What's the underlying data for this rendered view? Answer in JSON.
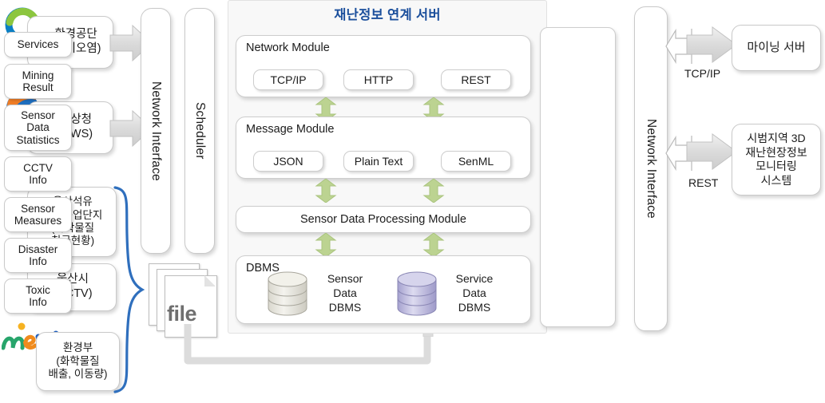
{
  "server": {
    "title": "재난정보 연계 서버",
    "title_color": "#1b4f9c",
    "modules": [
      {
        "label": "Network Module",
        "chips": [
          "TCP/IP",
          "HTTP",
          "REST"
        ]
      },
      {
        "label": "Message Module",
        "chips": [
          "JSON",
          "Plain Text",
          "SenML"
        ]
      }
    ],
    "processing_module": "Sensor Data Processing Module",
    "dbms": {
      "label": "DBMS",
      "stores": [
        {
          "name": "Sensor\nData\nDBMS",
          "line1": "Sensor",
          "line2": "Data",
          "line3": "DBMS",
          "color": "#e8e6de"
        },
        {
          "name": "Service\nData\nDBMS",
          "line1": "Service",
          "line2": "Data",
          "line3": "DBMS",
          "color": "#bfbcdf"
        }
      ]
    }
  },
  "services": {
    "header": "Services",
    "items": [
      {
        "lines": [
          "Mining",
          "Result"
        ]
      },
      {
        "lines": [
          "Sensor",
          "Data",
          "Statistics"
        ]
      },
      {
        "lines": [
          "CCTV",
          "Info"
        ]
      },
      {
        "lines": [
          "Sensor",
          "Measures"
        ]
      },
      {
        "lines": [
          "Disaster",
          "Info"
        ]
      },
      {
        "lines": [
          "Toxic",
          "Info"
        ]
      }
    ]
  },
  "columns": {
    "left_network_interface": "Network Interface",
    "scheduler": "Scheduler",
    "right_network_interface": "Network Interface"
  },
  "sources": [
    {
      "icon": "keco-logo-icon",
      "lines": [
        "환경공단",
        "(대기오염)"
      ]
    },
    {
      "icon": "kma-logo-icon",
      "lines": [
        "기상청",
        "(AWS)"
      ]
    },
    {
      "icon": "",
      "lines": [
        "울산석유",
        "화학공업단지",
        "(화학물질",
        "취급현황)"
      ]
    },
    {
      "icon": "ulsan-logo-icon",
      "lines": [
        "울산시",
        "(CCTV)"
      ]
    },
    {
      "icon": "me-logo-icon",
      "lines": [
        "환경부",
        "(화학물질",
        "배출, 이동량)"
      ]
    }
  ],
  "file_stack": {
    "label": "file"
  },
  "targets": [
    {
      "protocol": "TCP/IP",
      "lines": [
        "마이닝 서버"
      ]
    },
    {
      "protocol": "REST",
      "lines": [
        "시범지역 3D",
        "재난현장정보",
        "모니터링",
        "시스템"
      ]
    }
  ],
  "palette": {
    "green_arrow": "#b7d18b",
    "gray_arrow": "#d6d6d6",
    "brace_blue": "#2f6fbd",
    "panel_bg": "#f8f8f8"
  }
}
